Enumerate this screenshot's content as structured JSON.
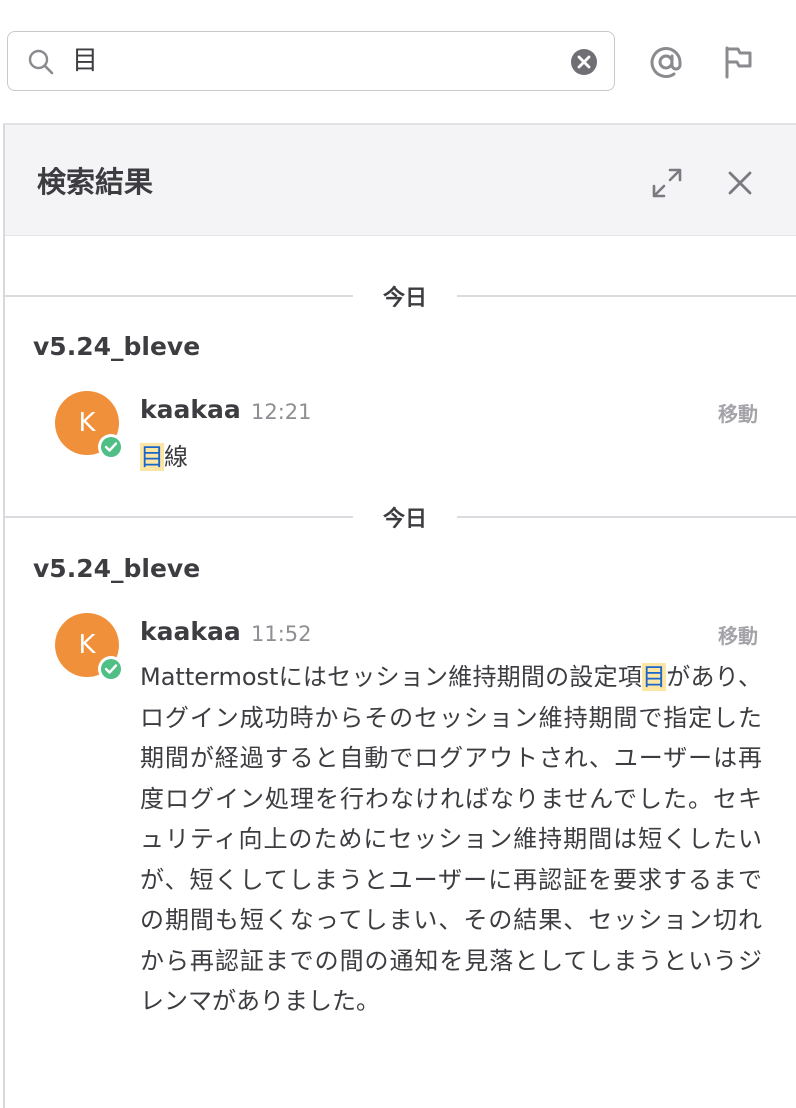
{
  "search": {
    "value": "目"
  },
  "panel": {
    "title": "検索結果"
  },
  "results": [
    {
      "date": "今日",
      "channel": "v5.24_bleve",
      "avatar_letter": "K",
      "username": "kaakaa",
      "time": "12:21",
      "jump_label": "移動",
      "message_pre": "",
      "message_hl": "目",
      "message_post": "線"
    },
    {
      "date": "今日",
      "channel": "v5.24_bleve",
      "avatar_letter": "K",
      "username": "kaakaa",
      "time": "11:52",
      "jump_label": "移動",
      "message_pre": "Mattermostにはセッション維持期間の設定項",
      "message_hl": "目",
      "message_post": "があり、ログイン成功時からそのセッション維持期間で指定した期間が経過すると自動でログアウトされ、ユーザーは再度ログイン処理を行わなければなりませんでした。セキュリティ向上のためにセッション維持期間は短くしたいが、短くしてしまうとユーザーに再認証を要求するまでの期間も短くなってしまい、その結果、セッション切れから再認証までの間の通知を見落としてしまうというジレンマがありました。"
    }
  ],
  "colors": {
    "accent": "#1a66c9",
    "highlight": "#fde5a3",
    "avatar": "#f0903a",
    "online": "#4fbf86"
  }
}
